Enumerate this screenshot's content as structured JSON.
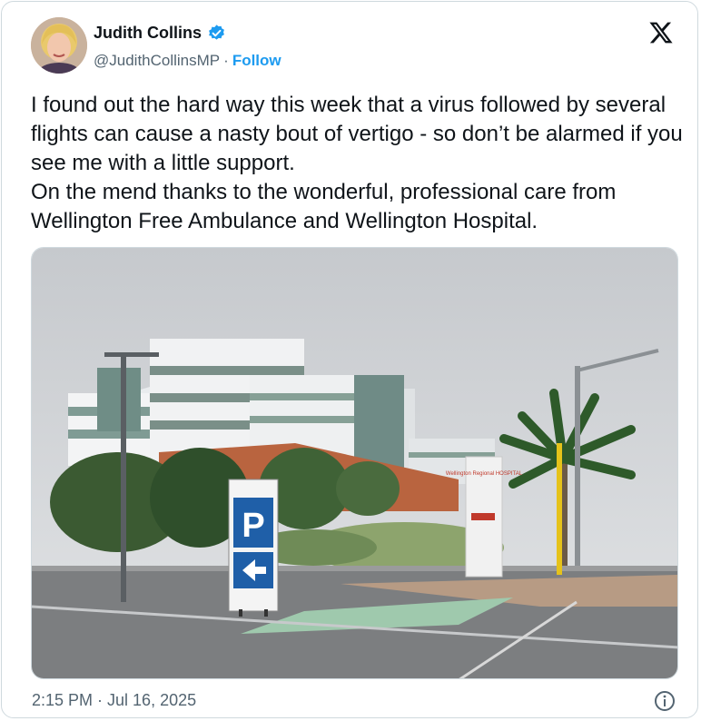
{
  "author": {
    "name": "Judith Collins",
    "handle": "@JudithCollinsMP",
    "separator": "·",
    "follow_label": "Follow",
    "verified": true
  },
  "tweet": {
    "text": "I found out the hard way this week that a virus followed by several flights can cause a nasty bout of vertigo - so don’t be alarmed if you see me with a little support.\nOn the mend thanks to the wonderful, professional care from Wellington Free Ambulance and Wellington Hospital.",
    "timestamp": "2:15 PM · Jul 16, 2025"
  },
  "media": {
    "sign_text": "Wellington Regional HOSPITAL",
    "parking_letter": "P"
  },
  "colors": {
    "accent": "#1d9bf0",
    "text": "#0f1419",
    "muted": "#536471"
  },
  "icons": {
    "brand": "x-logo-icon",
    "verified": "verified-badge-icon",
    "info": "info-icon"
  }
}
